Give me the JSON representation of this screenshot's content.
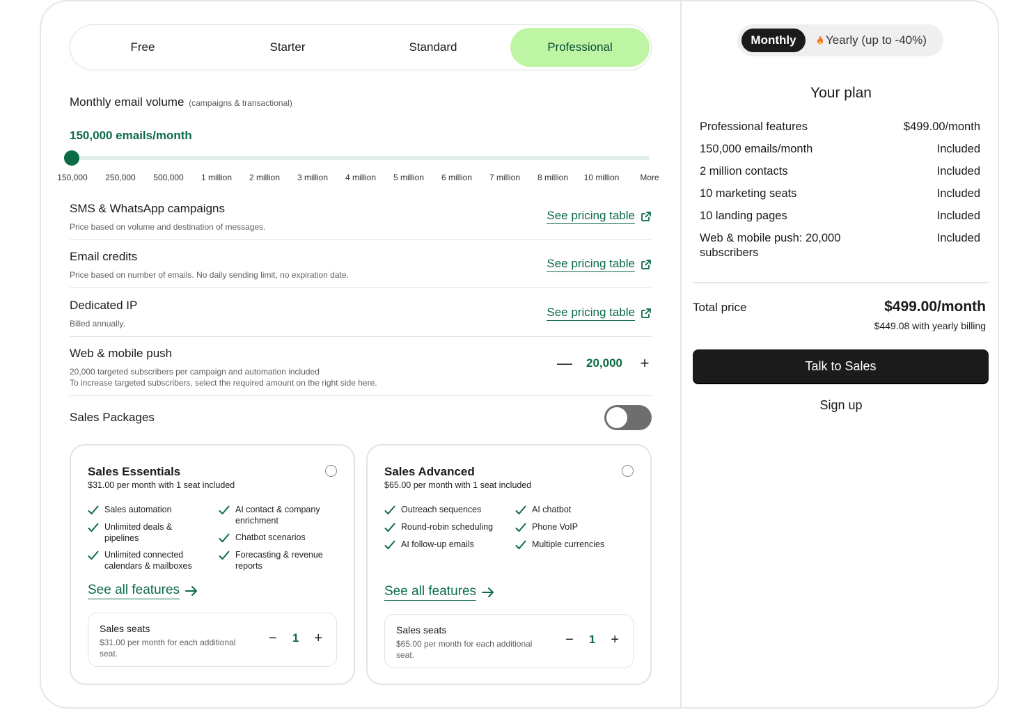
{
  "tabs": [
    {
      "label": "Free"
    },
    {
      "label": "Starter"
    },
    {
      "label": "Standard"
    },
    {
      "label": "Professional",
      "active": true
    }
  ],
  "volume": {
    "heading": "Monthly email volume",
    "subheading": "(campaigns & transactional)",
    "value": "150,000 emails/month",
    "ticks": [
      "150,000",
      "250,000",
      "500,000",
      "1 million",
      "2 million",
      "3 million",
      "4 million",
      "5 million",
      "6 million",
      "7 million",
      "8 million",
      "10 million",
      "More"
    ],
    "selected_index": 0
  },
  "sms": {
    "title": "SMS & WhatsApp campaigns",
    "desc": "Price based on volume and destination of messages.",
    "link": "See pricing table"
  },
  "credits": {
    "title": "Email credits",
    "desc": "Price based on number of emails. No daily sending limit, no expiration date.",
    "link": "See pricing table"
  },
  "ip": {
    "title": "Dedicated IP",
    "desc": "Billed annually.",
    "link": "See pricing table"
  },
  "push": {
    "title": "Web & mobile push",
    "desc1": "20,000 targeted subscribers per campaign and automation included",
    "desc2": "To increase targeted subscribers, select the required amount on the right side here.",
    "minus": "—",
    "value": "20,000",
    "plus": "+"
  },
  "sales_packages": {
    "title": "Sales Packages",
    "enabled": false
  },
  "essentials": {
    "title": "Sales Essentials",
    "subtitle": "$31.00 per month with 1 seat included",
    "features_left": [
      "Sales automation",
      "Unlimited deals & pipelines",
      "Unlimited connected calendars & mailboxes"
    ],
    "features_right": [
      "AI contact & company enrichment",
      "Chatbot scenarios",
      "Forecasting & revenue reports"
    ],
    "see_all": "See all features",
    "seats_title": "Sales seats",
    "seats_desc": "$31.00 per month for each additional seat.",
    "seats_minus": "−",
    "seats_value": "1",
    "seats_plus": "+"
  },
  "advanced": {
    "title": "Sales Advanced",
    "subtitle": "$65.00 per month with 1 seat included",
    "features_left": [
      "Outreach sequences",
      "Round-robin scheduling",
      "AI follow-up emails"
    ],
    "features_right": [
      "AI chatbot",
      "Phone VoIP",
      "Multiple currencies"
    ],
    "see_all": "See all features",
    "seats_title": "Sales seats",
    "seats_desc": "$65.00 per month for each additional seat.",
    "seats_minus": "−",
    "seats_value": "1",
    "seats_plus": "+"
  },
  "billing": {
    "monthly": "Monthly",
    "yearly": "Yearly (up to -40%)",
    "yearly_icon": "fire-icon"
  },
  "plan": {
    "title": "Your plan",
    "rows": [
      {
        "label": "Professional features",
        "value": "$499.00/month"
      },
      {
        "label": "150,000 emails/month",
        "value": "Included"
      },
      {
        "label": "2 million contacts",
        "value": "Included"
      },
      {
        "label": "10 marketing seats",
        "value": "Included"
      },
      {
        "label": "10 landing pages",
        "value": "Included"
      },
      {
        "label": "Web & mobile push: 20,000 subscribers",
        "value": "Included"
      }
    ],
    "total_label": "Total price",
    "total_value": "$499.00/month",
    "total_sub": "$449.08 with yearly billing",
    "cta": "Talk to Sales",
    "signup": "Sign up"
  },
  "colors": {
    "accent": "#0b6b45",
    "tab_active_bg": "#bef5a4",
    "dark": "#1b1b1b"
  }
}
